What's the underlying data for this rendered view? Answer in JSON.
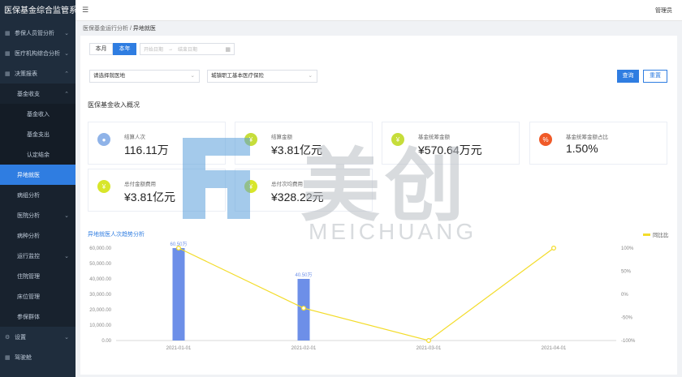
{
  "app": {
    "title": "医保基金综合监管系统"
  },
  "topbar": {
    "menu_icon": "hamburger-icon",
    "user": "管理员"
  },
  "sidebar": {
    "items": [
      {
        "label": "参保人员管分析",
        "icon": "grid-icon",
        "level": 0,
        "chevron": "down"
      },
      {
        "label": "医疗机构综合分析",
        "icon": "grid-icon",
        "level": 0,
        "chevron": "down"
      },
      {
        "label": "决策报表",
        "icon": "grid-icon",
        "level": 0,
        "chevron": "up"
      },
      {
        "label": "基金收支",
        "icon": "",
        "level": 1,
        "chevron": "up"
      },
      {
        "label": "基金收入",
        "icon": "",
        "level": 2,
        "chevron": ""
      },
      {
        "label": "基金支出",
        "icon": "",
        "level": 2,
        "chevron": ""
      },
      {
        "label": "认定结余",
        "icon": "",
        "level": 2,
        "chevron": ""
      },
      {
        "label": "异地就医",
        "icon": "",
        "level": 1,
        "chevron": "",
        "active": true
      },
      {
        "label": "病组分析",
        "icon": "",
        "level": 1,
        "chevron": ""
      },
      {
        "label": "医院分析",
        "icon": "",
        "level": 1,
        "chevron": "down"
      },
      {
        "label": "病种分析",
        "icon": "",
        "level": 1,
        "chevron": ""
      },
      {
        "label": "运行监控",
        "icon": "",
        "level": 1,
        "chevron": "down"
      },
      {
        "label": "住院管理",
        "icon": "",
        "level": 1,
        "chevron": ""
      },
      {
        "label": "床位管理",
        "icon": "",
        "level": 1,
        "chevron": ""
      },
      {
        "label": "参保群体",
        "icon": "",
        "level": 1,
        "chevron": ""
      },
      {
        "label": "设置",
        "icon": "gear-icon",
        "level": 0,
        "chevron": "down"
      },
      {
        "label": "驾驶舱",
        "icon": "grid-icon",
        "level": 0,
        "chevron": ""
      }
    ]
  },
  "breadcrumb": {
    "parent": "医保基金运行分析",
    "separator": "/",
    "current": "异地就医"
  },
  "filters": {
    "period_buttons": [
      "本月",
      "本年"
    ],
    "active_period": "本年",
    "date_start_placeholder": "开始日期",
    "date_sep": "→",
    "date_end_placeholder": "结束日期",
    "select_1": "请选择就医地",
    "select_2": "城镇职工基本医疗保险",
    "query_label": "查询",
    "reset_label": "重置"
  },
  "section": {
    "title": "医保基金收入概况"
  },
  "cards": [
    {
      "label": "结算人次",
      "value": "116.11万",
      "icon": "user-icon",
      "color": "#8fb3e8"
    },
    {
      "label": "结算金额",
      "value": "¥3.81亿元",
      "icon": "money-bag-icon",
      "color": "#c6dd3a"
    },
    {
      "label": "基金统筹金额",
      "value": "¥570.64万元",
      "icon": "money-bag-icon",
      "color": "#c6dd3a"
    },
    {
      "label": "基金统筹金额占比",
      "value": "1.50%",
      "icon": "percent-icon",
      "color": "#f05a28"
    },
    {
      "label": "总付金额费用",
      "value": "¥3.81亿元",
      "icon": "money-bag-icon",
      "color": "#d8e62a"
    },
    {
      "label": "总付次均费用",
      "value": "¥328.22元",
      "icon": "money-bag-icon",
      "color": "#d8e62a"
    }
  ],
  "chart_title": "异地就医人次趋势分析",
  "watermark": {
    "text": "美创",
    "sub": "MEICHUANG",
    "icon": "meichuang-logo-icon"
  },
  "chart_data": {
    "type": "bar",
    "categories": [
      "2021-01-01",
      "2021-02-01",
      "2021-03-01",
      "2021-04-01"
    ],
    "series": [
      {
        "type": "bar",
        "axis": "left",
        "values": [
          60,
          40,
          null,
          null
        ],
        "labels": [
          "60.50万",
          "40.50万",
          "",
          ""
        ],
        "color": "#6d8fe8"
      },
      {
        "name": "同比比",
        "type": "line",
        "axis": "right",
        "values": [
          100,
          -30,
          -100,
          100
        ],
        "color": "#f3dc2a"
      }
    ],
    "y_left": {
      "min": 0,
      "max": 60,
      "ticks": [
        "0.00",
        "10,000.00",
        "20,000.00",
        "30,000.00",
        "40,000.00",
        "50,000.00",
        "60,000.00"
      ]
    },
    "y_right": {
      "min": -100,
      "max": 100,
      "ticks": [
        "-100%",
        "-50%",
        "0%",
        "50%",
        "100%"
      ]
    },
    "legend_position": "top-right",
    "grid": false
  }
}
